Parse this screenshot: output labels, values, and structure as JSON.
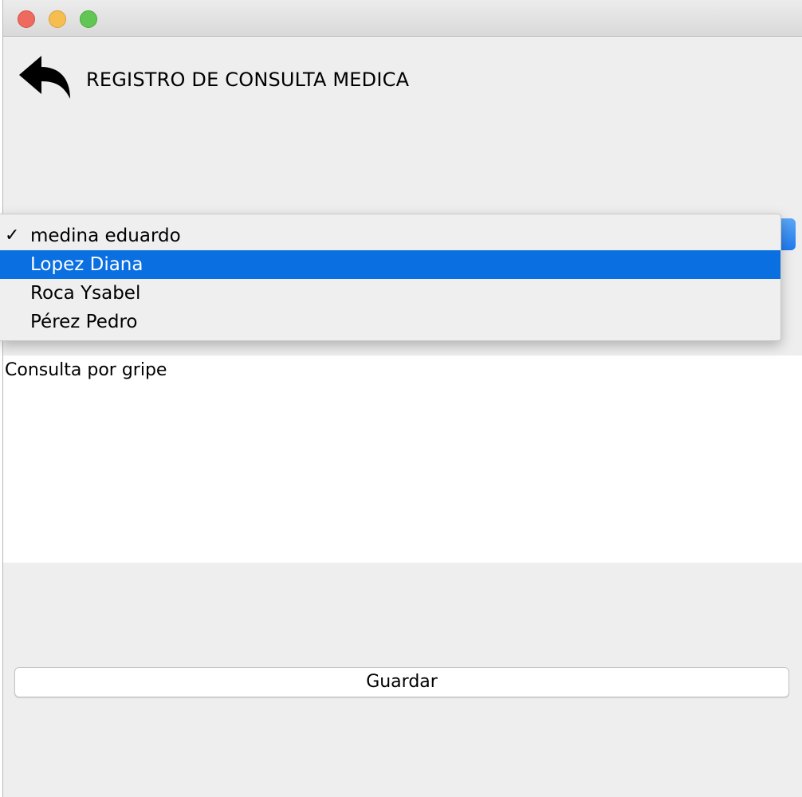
{
  "window": {
    "title_bar_buttons": [
      "close",
      "minimize",
      "zoom"
    ]
  },
  "header": {
    "title": "REGISTRO DE CONSULTA MEDICA",
    "back_icon": "reply-arrow-icon"
  },
  "patient_select": {
    "current_value": "medina eduardo",
    "options": [
      {
        "label": "medina eduardo",
        "checked": true,
        "highlighted": false
      },
      {
        "label": "Lopez Diana",
        "checked": false,
        "highlighted": true
      },
      {
        "label": "Roca Ysabel",
        "checked": false,
        "highlighted": false
      },
      {
        "label": "Pérez Pedro",
        "checked": false,
        "highlighted": false
      }
    ],
    "check_mark": "✓"
  },
  "notes": {
    "value": "Consulta por gripe"
  },
  "actions": {
    "save_label": "Guardar"
  },
  "colors": {
    "accent": "#0a6fe1",
    "window_bg": "#eeeeee",
    "close": "#ee6a5e",
    "minimize": "#f5be4f",
    "zoom": "#62c655"
  }
}
